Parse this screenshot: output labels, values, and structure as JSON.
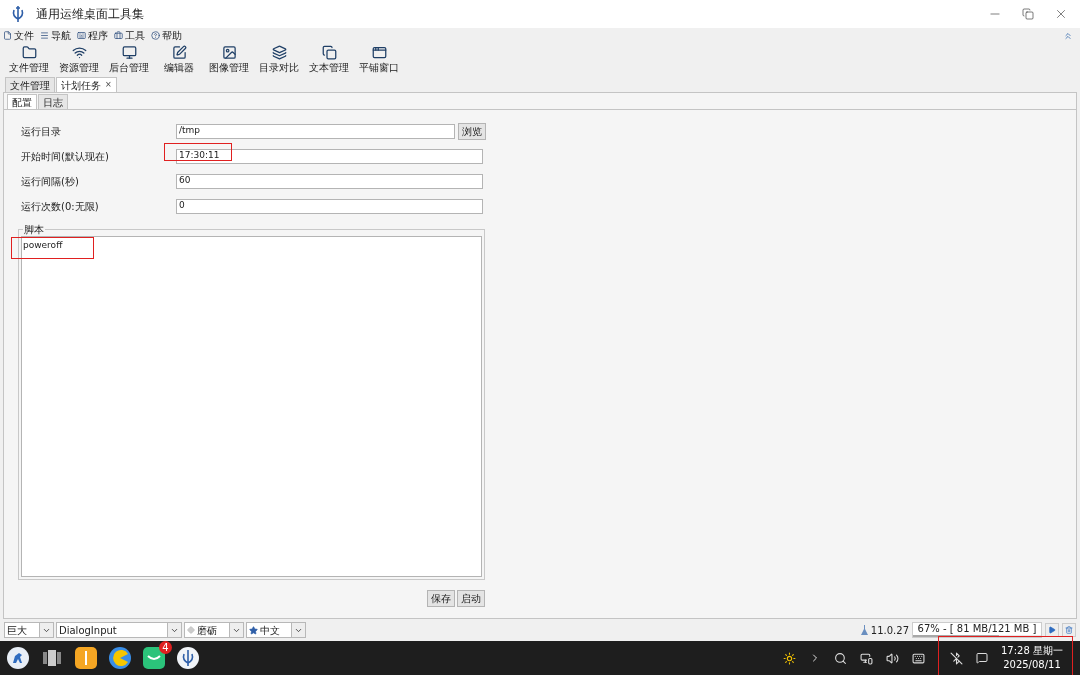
{
  "window": {
    "title": "通用运维桌面工具集"
  },
  "menu": [
    {
      "label": "文件"
    },
    {
      "label": "导航"
    },
    {
      "label": "程序"
    },
    {
      "label": "工具"
    },
    {
      "label": "帮助"
    }
  ],
  "toolbar": [
    {
      "label": "文件管理"
    },
    {
      "label": "资源管理"
    },
    {
      "label": "后台管理"
    },
    {
      "label": "编辑器"
    },
    {
      "label": "图像管理"
    },
    {
      "label": "目录对比"
    },
    {
      "label": "文本管理"
    },
    {
      "label": "平铺窗口"
    }
  ],
  "doc_tabs": [
    {
      "label": "文件管理",
      "selected": false
    },
    {
      "label": "计划任务",
      "selected": true,
      "close": "×"
    }
  ],
  "sub_tabs": [
    {
      "label": "配置",
      "selected": true
    },
    {
      "label": "日志",
      "selected": false
    }
  ],
  "fields": [
    {
      "label": "运行目录",
      "value": "/tmp",
      "button": "浏览",
      "highlighted": false
    },
    {
      "label": "开始时间(默认现在)",
      "value": "17:30:11",
      "highlighted": true
    },
    {
      "label": "运行间隔(秒)",
      "value": "60",
      "highlighted": false
    },
    {
      "label": "运行次数(0:无限)",
      "value": "0",
      "highlighted": false
    }
  ],
  "script": {
    "label": "脚本",
    "value": "poweroff",
    "highlighted": true
  },
  "actions": [
    "保存",
    "启动"
  ],
  "status_bar": {
    "combos": [
      {
        "value": "巨大"
      },
      {
        "value": "DialogInput"
      },
      {
        "value": "磨砺"
      },
      {
        "value": "中文"
      }
    ],
    "version": "11.0.27",
    "memory": {
      "text": "67% - [ 81 MB/121 MB ]",
      "level": 0.67
    }
  },
  "taskbar": {
    "mail_badge": "4",
    "time": "17:28 星期一",
    "date": "2025/08/11",
    "highlighted": true
  }
}
